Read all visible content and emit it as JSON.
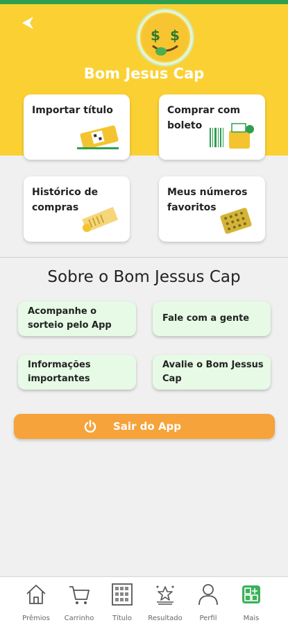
{
  "header": {
    "title": "Bom Jesus Cap"
  },
  "actions": [
    {
      "label": "Importar título"
    },
    {
      "label": "Comprar com boleto"
    },
    {
      "label": "Histórico de compras"
    },
    {
      "label": "Meus números favoritos"
    }
  ],
  "about": {
    "title": "Sobre o Bom Jessus Cap",
    "buttons": [
      {
        "label": "Acompanhe o sorteio pelo App"
      },
      {
        "label": "Fale com a gente"
      },
      {
        "label": "Informações importantes"
      },
      {
        "label": "Avalie o Bom Jessus Cap"
      }
    ]
  },
  "logout": {
    "label": "Sair do App"
  },
  "nav": [
    {
      "label": "Prêmios",
      "icon": "house-icon"
    },
    {
      "label": "Carrinho",
      "icon": "cart-icon"
    },
    {
      "label": "Título",
      "icon": "ticket-grid-icon"
    },
    {
      "label": "Resultado",
      "icon": "stars-icon"
    },
    {
      "label": "Perfil",
      "icon": "person-icon"
    },
    {
      "label": "Mais",
      "icon": "more-grid-icon",
      "active": true
    }
  ],
  "colors": {
    "header": "#fbd033",
    "accent_green": "#2e9e4f",
    "logout": "#f5a33a",
    "light_green": "#e6fae6"
  }
}
